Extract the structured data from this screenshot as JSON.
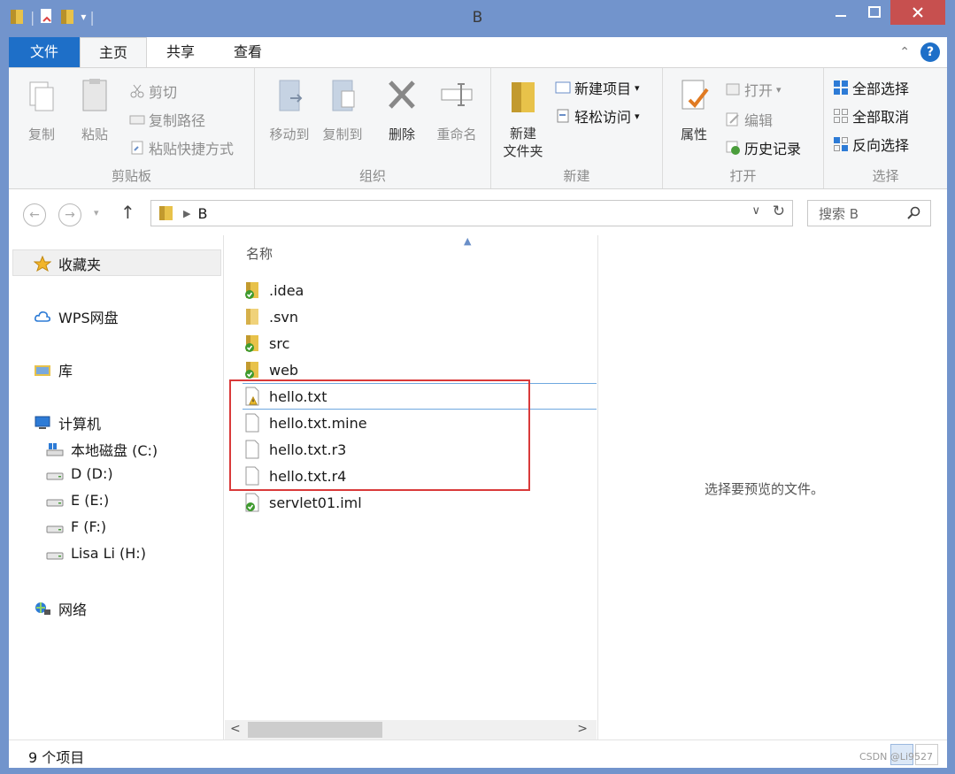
{
  "window": {
    "title": "B"
  },
  "ribbon_tabs": {
    "file": "文件",
    "home": "主页",
    "share": "共享",
    "view": "查看"
  },
  "clipboard": {
    "copy": "复制",
    "paste": "粘贴",
    "cut": "剪切",
    "copy_path": "复制路径",
    "paste_shortcut": "粘贴快捷方式",
    "label": "剪贴板"
  },
  "organize": {
    "move_to": "移动到",
    "copy_to": "复制到",
    "delete": "删除",
    "rename": "重命名",
    "label": "组织"
  },
  "new_group": {
    "new_folder": "新建\n文件夹",
    "new_item": "新建项目",
    "easy_access": "轻松访问",
    "label": "新建"
  },
  "open_group": {
    "properties": "属性",
    "open": "打开",
    "edit": "编辑",
    "history": "历史记录",
    "label": "打开"
  },
  "select_group": {
    "select_all": "全部选择",
    "select_none": "全部取消",
    "invert": "反向选择",
    "label": "选择"
  },
  "address": {
    "path": "B",
    "search_placeholder": "搜索 B"
  },
  "nav": {
    "favorites": "收藏夹",
    "wps": "WPS网盘",
    "library": "库",
    "computer": "计算机",
    "drives": [
      "本地磁盘 (C:)",
      "D (D:)",
      "E (E:)",
      "F (F:)",
      "Lisa Li (H:)"
    ],
    "network": "网络"
  },
  "files": {
    "column_name": "名称",
    "items": [
      {
        "name": ".idea",
        "icon": "folder-check-icon"
      },
      {
        "name": ".svn",
        "icon": "folder-icon"
      },
      {
        "name": "src",
        "icon": "folder-check-icon"
      },
      {
        "name": "web",
        "icon": "folder-check-icon"
      },
      {
        "name": "hello.txt",
        "icon": "file-warning-icon"
      },
      {
        "name": "hello.txt.mine",
        "icon": "file-icon"
      },
      {
        "name": "hello.txt.r3",
        "icon": "file-icon"
      },
      {
        "name": "hello.txt.r4",
        "icon": "file-icon"
      },
      {
        "name": "servlet01.iml",
        "icon": "file-check-icon"
      }
    ]
  },
  "preview": {
    "message": "选择要预览的文件。"
  },
  "status": {
    "count": "9 个项目"
  },
  "watermark": "CSDN @Li9527",
  "colors": {
    "accent": "#1e6fc8",
    "titlebar": "#7294cc",
    "close": "#c7504f",
    "highlight": "#d93a3a"
  }
}
